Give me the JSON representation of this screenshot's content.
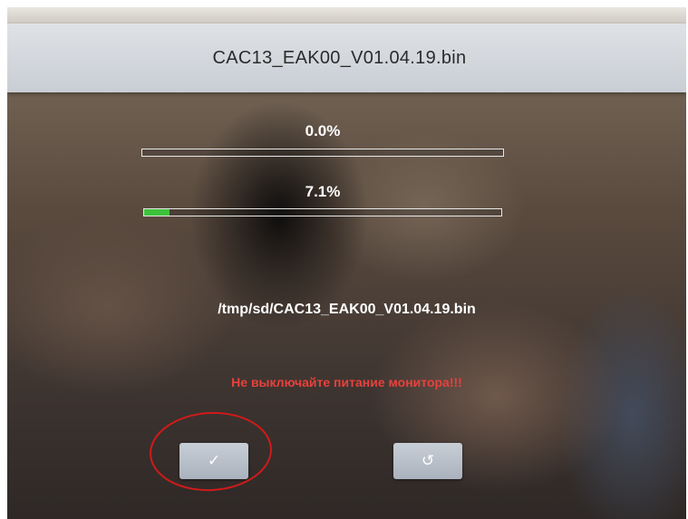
{
  "window": {
    "title": "CAC13_EAK00_V01.04.19.bin"
  },
  "progress": [
    {
      "label": "0.0%",
      "value": 0.0
    },
    {
      "label": "7.1%",
      "value": 7.1
    }
  ],
  "file_path": "/tmp/sd/CAC13_EAK00_V01.04.19.bin",
  "warning_text": "Не выключайте питание монитора!!!",
  "buttons": {
    "confirm_icon": "✓",
    "back_icon": "↺"
  },
  "icons": {
    "confirm": "checkmark-icon",
    "back": "return-icon"
  },
  "colors": {
    "progress_fill": "#3ec23b",
    "warning": "#e8413c",
    "annotation_circle": "#d11a1a"
  }
}
